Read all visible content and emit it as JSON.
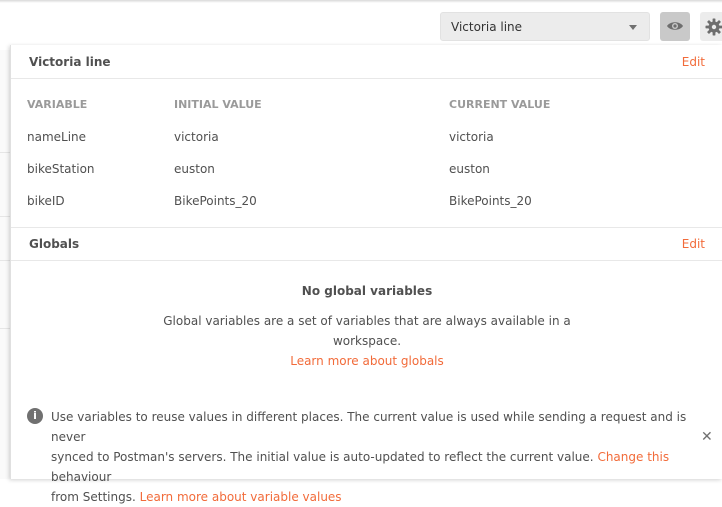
{
  "header": {
    "env_selector": {
      "value": "Victoria line"
    }
  },
  "environment": {
    "title": "Victoria line",
    "edit_label": "Edit",
    "columns": [
      "VARIABLE",
      "INITIAL VALUE",
      "CURRENT VALUE"
    ],
    "rows": [
      [
        "nameLine",
        "victoria",
        "victoria"
      ],
      [
        "bikeStation",
        "euston",
        "euston"
      ],
      [
        "bikeID",
        "BikePoints_20",
        "BikePoints_20"
      ]
    ]
  },
  "globals": {
    "title": "Globals",
    "edit_label": "Edit",
    "empty_title": "No global variables",
    "empty_desc_line1": "Global variables are a set of variables that are always available in a",
    "empty_desc_line2": "workspace.",
    "learn_link": "Learn more about globals"
  },
  "info": {
    "line1": "Use variables to reuse values in different places. The current value is used while sending a request and is never",
    "line2_pre": "synced to Postman's servers. The initial value is auto-updated to reflect the current value.",
    "line2_link": "Change this",
    "line2_post": "behaviour",
    "line3_pre": "from Settings.",
    "line3_link": "Learn more about variable values"
  },
  "colors": {
    "accent": "#f26b3a",
    "text": "#505050",
    "muted": "#9a9a9a"
  },
  "icons": [
    "chevron-down-icon",
    "eye-icon",
    "gear-icon",
    "info-icon",
    "close-icon"
  ]
}
